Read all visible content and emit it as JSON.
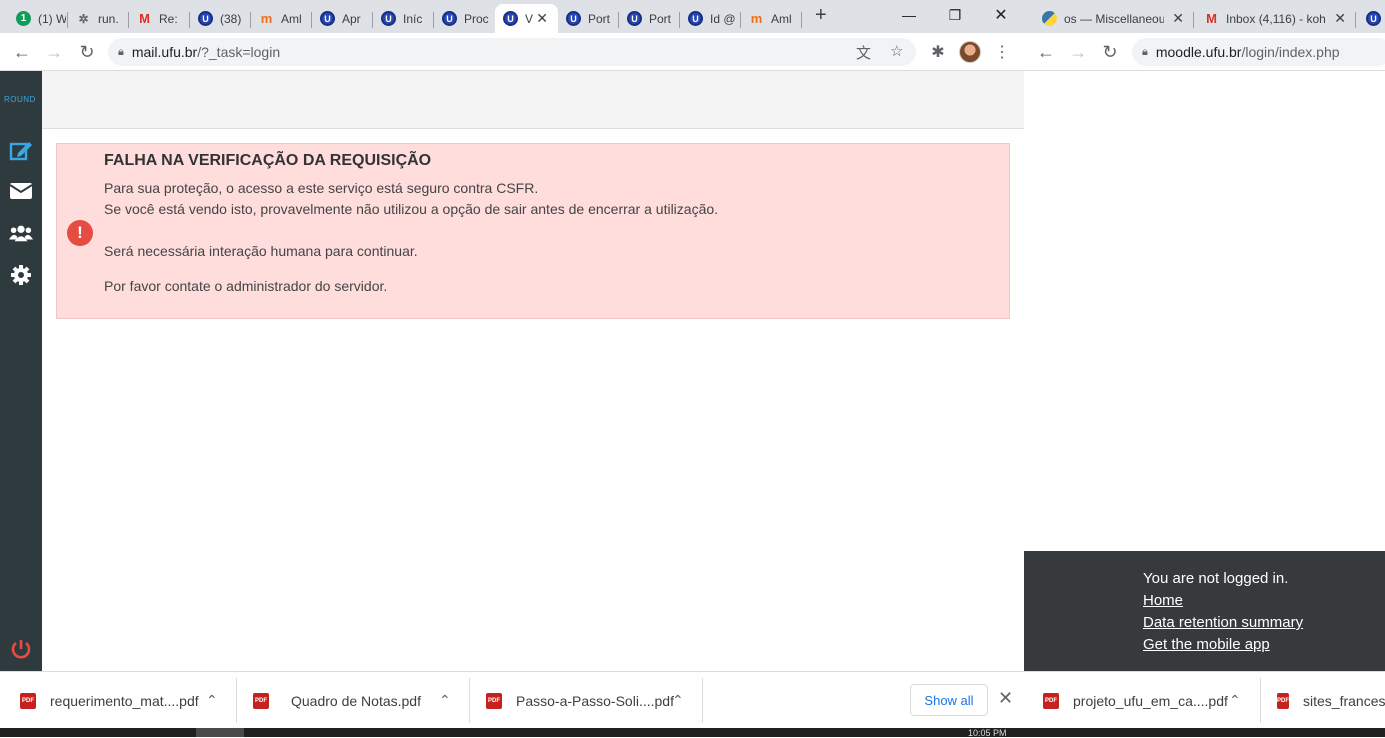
{
  "left_window": {
    "tabs": [
      {
        "icon": "whatsapp-icon",
        "label": "(1) W"
      },
      {
        "icon": "runrun-icon",
        "label": "run."
      },
      {
        "icon": "gmail-icon",
        "label": "Re:"
      },
      {
        "icon": "ufu-icon",
        "label": "(38)"
      },
      {
        "icon": "moodle-icon",
        "label": "Aml"
      },
      {
        "icon": "ufu-icon",
        "label": "Apr"
      },
      {
        "icon": "ufu-icon",
        "label": "Iníc"
      },
      {
        "icon": "ufu-icon",
        "label": "Proc"
      },
      {
        "icon": "ufu-icon",
        "label": "V",
        "active": true
      },
      {
        "icon": "ufu-icon",
        "label": "Port"
      },
      {
        "icon": "ufu-icon",
        "label": "Port"
      },
      {
        "icon": "ufu-icon",
        "label": "Id @"
      },
      {
        "icon": "moodle-icon",
        "label": "Aml"
      }
    ],
    "url_host": "mail.ufu.br",
    "url_rest": "/?_task=login",
    "sidebar": {
      "logo": "ROUND",
      "items": [
        "compose-icon",
        "mail-icon",
        "contacts-icon",
        "settings-icon"
      ],
      "logout": "power-icon"
    },
    "alert": {
      "title": "FALHA NA VERIFICAÇÃO DA REQUISIÇÃO",
      "line1": "Para sua proteção, o acesso a este serviço está seguro contra CSFR.",
      "line2": "Se você está vendo isto, provavelmente não utilizou a opção de sair antes de encerrar a utilização.",
      "line3": "Será necessária interação humana para continuar.",
      "line4": "Por favor contate o administrador do servidor."
    }
  },
  "right_window": {
    "tabs": [
      {
        "icon": "python-icon",
        "label": "os — Miscellaneous"
      },
      {
        "icon": "gmail-icon",
        "label": "Inbox (4,116) - koh"
      },
      {
        "icon": "ufu-icon",
        "label": ""
      }
    ],
    "url_host": "moodle.ufu.br",
    "url_rest": "/login/index.php",
    "footer": {
      "status": "You are not logged in.",
      "link_home": "Home",
      "link_retention": "Data retention summary",
      "link_app": "Get the mobile app"
    }
  },
  "downloads": {
    "items": [
      "requerimento_mat....pdf",
      "Quadro de Notas.pdf",
      "Passo-a-Passo-Soli....pdf"
    ],
    "show_all": "Show all",
    "right_items": [
      "projeto_ufu_em_ca....pdf",
      "sites_frances_"
    ]
  },
  "taskbar": {
    "clock": "10:05 PM"
  }
}
